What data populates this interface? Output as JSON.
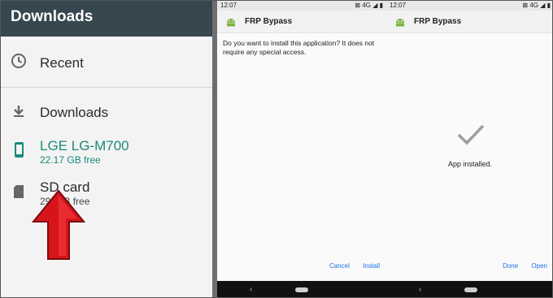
{
  "panel1": {
    "header_title": "Downloads",
    "items": [
      {
        "label": "Recent",
        "icon": "clock-icon"
      },
      {
        "label": "Downloads",
        "icon": "download-icon"
      },
      {
        "label": "LGE LG-M700",
        "sub": "22.17 GB free",
        "icon": "phone-icon",
        "selected": true
      },
      {
        "label": "SD card",
        "sub": "29.  GB free",
        "icon": "sd-card-icon"
      }
    ],
    "accent": "#1b8a78",
    "header_color": "#36474f"
  },
  "panel2": {
    "status_time": "12:07",
    "status_right": "⊠ 4G ◢ ▮",
    "app_title": "FRP Bypass",
    "prompt": "Do you want to install this application? It does not require any special access.",
    "cancel_label": "Cancel",
    "install_label": "Install",
    "nav_back": "‹"
  },
  "panel3": {
    "status_time": "12:07",
    "status_right": "⊠ 4G ◢ ▮",
    "app_title": "FRP Bypass",
    "installed_text": "App installed.",
    "done_label": "Done",
    "open_label": "Open",
    "nav_back": "‹"
  },
  "colors": {
    "action_blue": "#1a73e8",
    "arrow_red": "#d8141b"
  }
}
